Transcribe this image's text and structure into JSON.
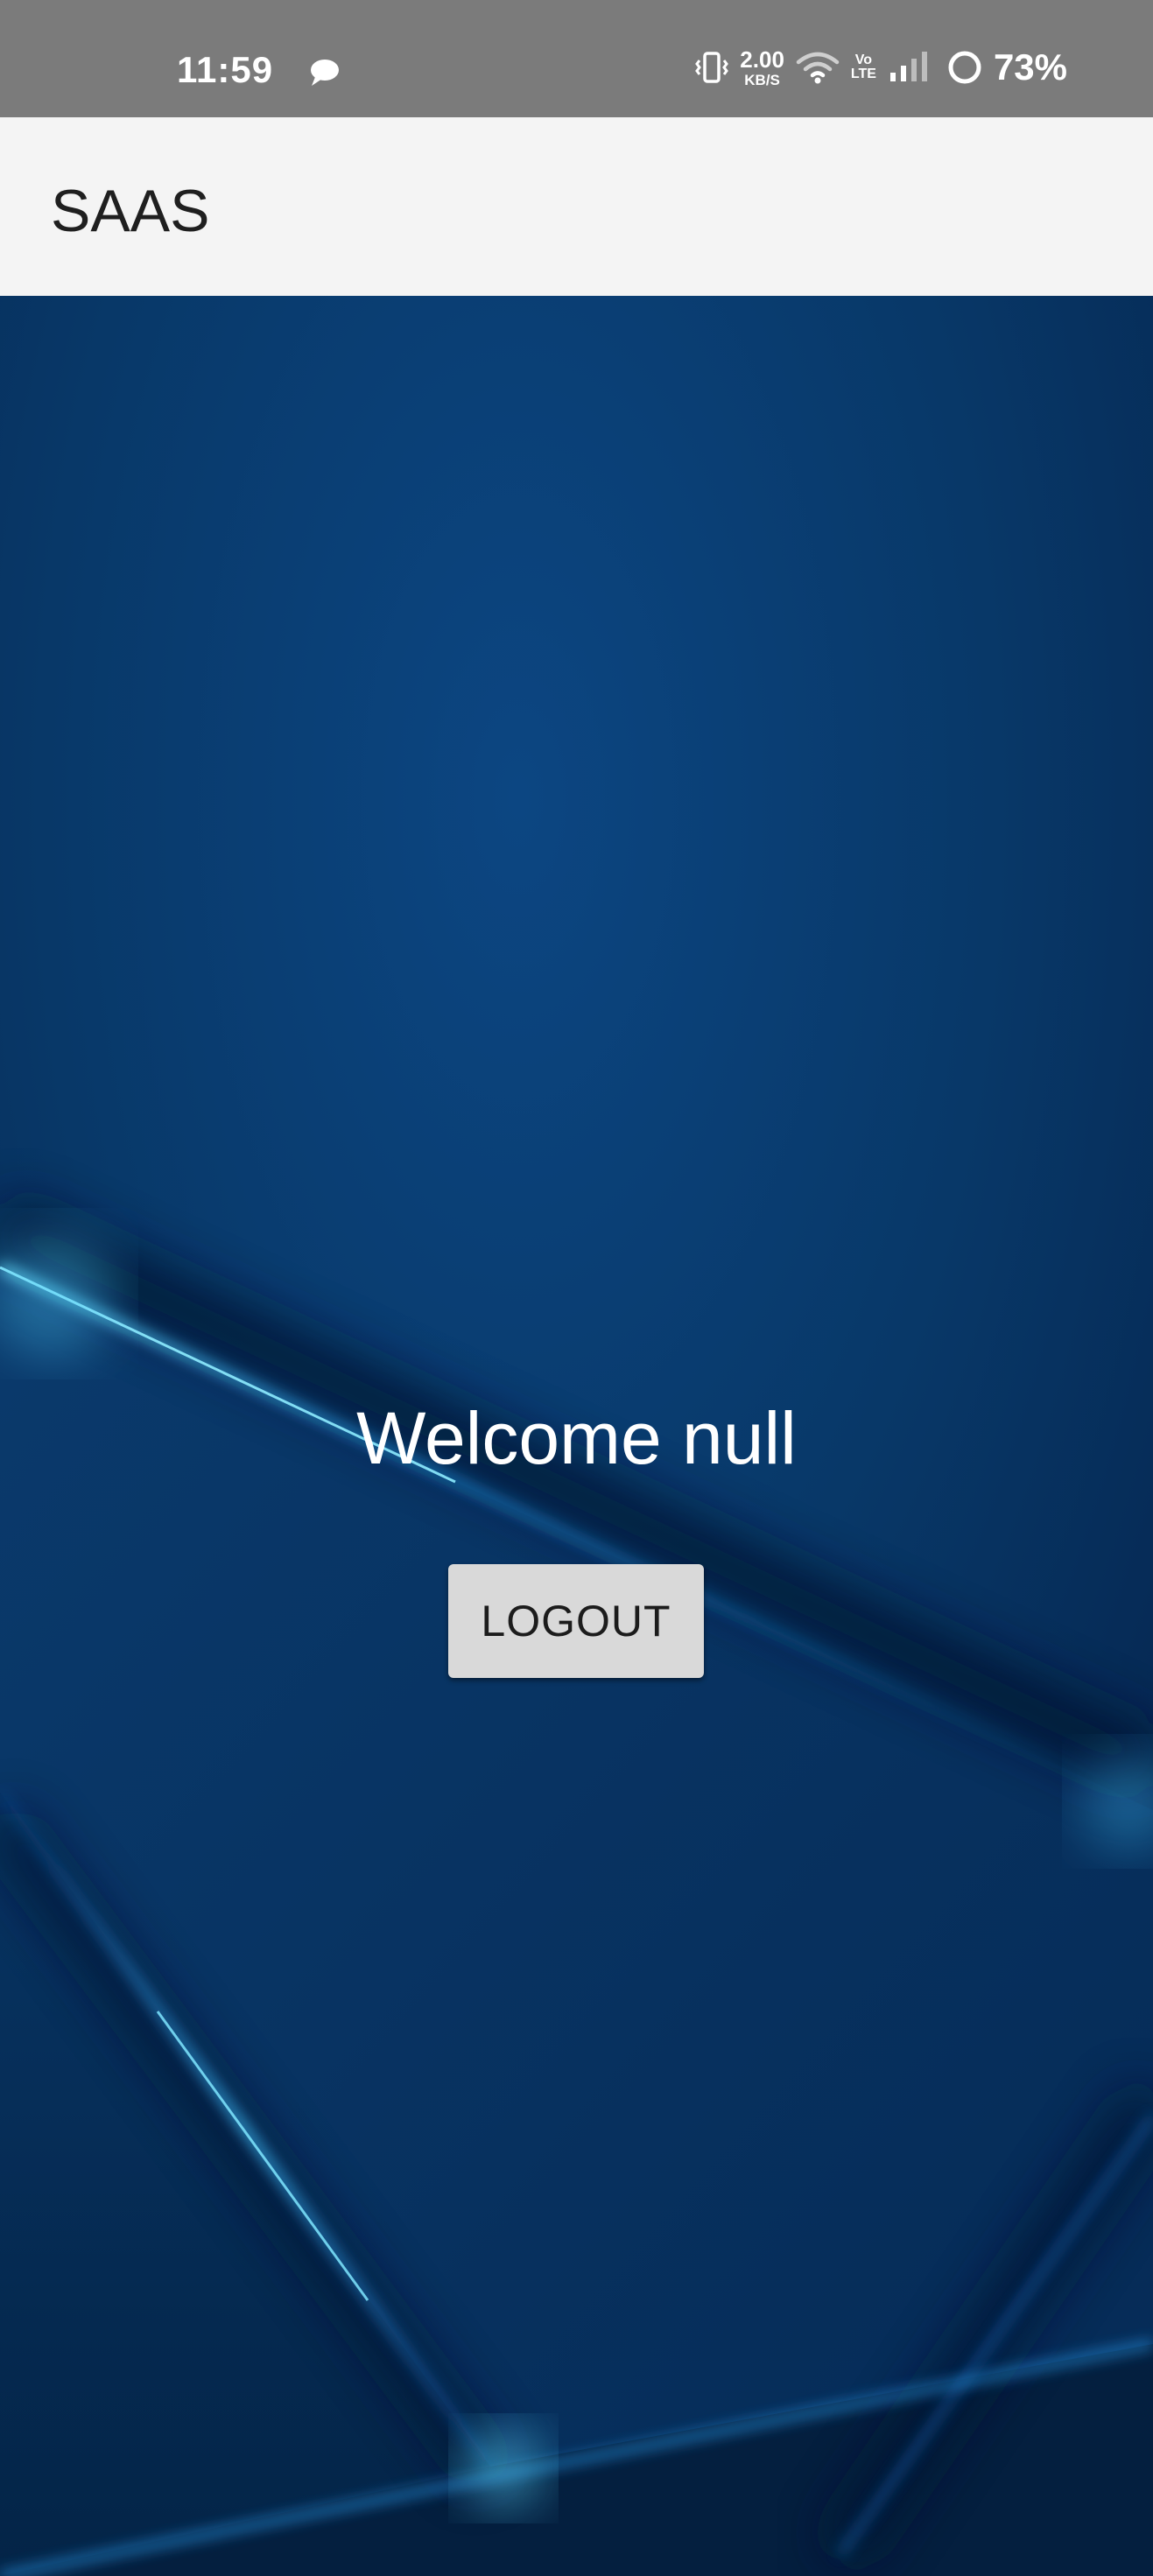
{
  "status_bar": {
    "time": "11:59",
    "net_speed_value": "2.00",
    "net_speed_unit": "KB/S",
    "volte_top": "Vo",
    "volte_bottom": "LTE",
    "battery": "73%",
    "icons": [
      "chat-bubble-icon",
      "vibrate-icon",
      "wifi-icon",
      "signal-icon",
      "battery-ring-icon"
    ]
  },
  "app_bar": {
    "title": "SAAS"
  },
  "main": {
    "welcome_text": "Welcome null",
    "logout_label": "LOGOUT"
  },
  "colors": {
    "status_bar_bg": "#7b7b7b",
    "app_bar_bg": "#f4f4f4",
    "background_dark": "#062447",
    "background_mid": "#0b3c6e",
    "accent_glow": "#3ac7ff",
    "button_bg": "#d9d9d9"
  }
}
